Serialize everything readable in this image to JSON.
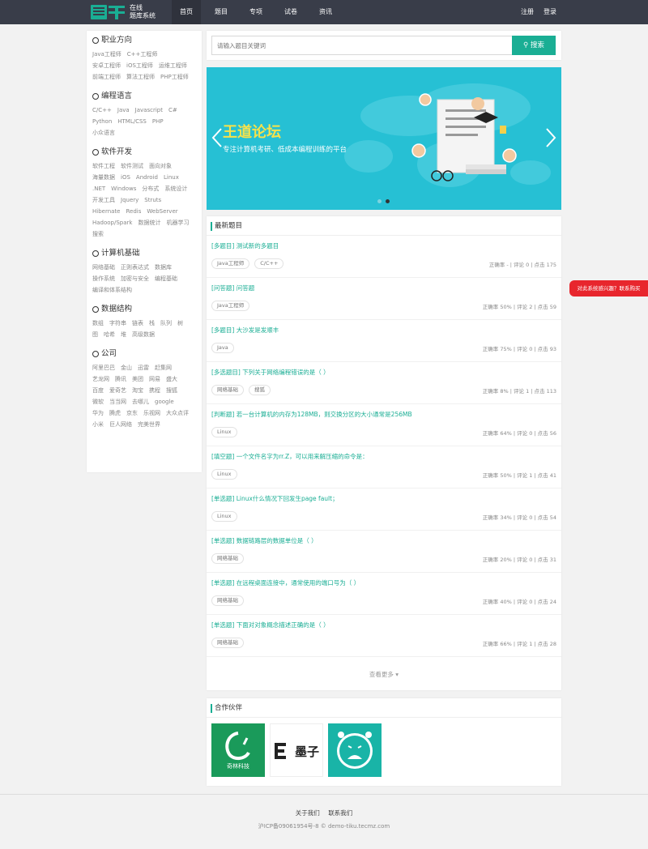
{
  "header": {
    "logo_text_line1": "在线",
    "logo_text_line2": "题库系统",
    "nav": [
      {
        "label": "首页",
        "active": true
      },
      {
        "label": "题目"
      },
      {
        "label": "专项"
      },
      {
        "label": "试卷"
      },
      {
        "label": "资讯"
      }
    ],
    "register_label": "注册",
    "login_label": "登录"
  },
  "sidebar": {
    "categories": [
      {
        "title": "职业方向",
        "tags": [
          "Java工程师",
          "C++工程师",
          "安卓工程师",
          "iOS工程师",
          "运维工程师",
          "前端工程师",
          "算法工程师",
          "PHP工程师"
        ]
      },
      {
        "title": "编程语言",
        "tags": [
          "C/C++",
          "Java",
          "Javascript",
          "C#",
          "Python",
          "HTML/CSS",
          "PHP",
          "小众语言"
        ]
      },
      {
        "title": "软件开发",
        "tags": [
          "软件工程",
          "软件测试",
          "面向对象",
          "海量数据",
          "iOS",
          "Android",
          "Linux",
          ".NET",
          "Windows",
          "分布式",
          "系统设计",
          "开发工具",
          "Jquery",
          "Struts",
          "Hibernate",
          "Redis",
          "WebServer",
          "Hadoop/Spark",
          "数据统计",
          "机器学习",
          "搜索"
        ]
      },
      {
        "title": "计算机基础",
        "tags": [
          "网络基础",
          "正则表达式",
          "数据库",
          "操作系统",
          "加密与安全",
          "编程基础",
          "编译和体系结构"
        ]
      },
      {
        "title": "数据结构",
        "tags": [
          "数组",
          "字符串",
          "链表",
          "栈",
          "队列",
          "树",
          "图",
          "哈希",
          "堆",
          "高级数据"
        ]
      },
      {
        "title": "公司",
        "tags": [
          "阿里巴巴",
          "金山",
          "迅雷",
          "赶集网",
          "艺龙网",
          "腾讯",
          "美团",
          "网易",
          "盛大",
          "百度",
          "爱奇艺",
          "淘宝",
          "携程",
          "搜狐",
          "微软",
          "当当网",
          "去哪儿",
          "google",
          "华为",
          "腾虎",
          "京东",
          "乐视网",
          "大众点评",
          "小米",
          "巨人网络",
          "完美世界"
        ]
      }
    ]
  },
  "search": {
    "placeholder": "请输入题目关键词",
    "button_label": "搜索"
  },
  "banner": {
    "title": "王道论坛",
    "subtitle": "专注计算机考研、低成本编程训练的平台"
  },
  "latest": {
    "heading": "最新题目",
    "questions": [
      {
        "title": "[多题目] 测试新的多题目",
        "tags": [
          "Java工程师",
          "C/C++"
        ],
        "stat": "正确率 - | 评论 0 | 点击 175"
      },
      {
        "title": "[问答题] 问答题",
        "tags": [
          "Java工程师"
        ],
        "stat": "正确率 50% | 评论 2 | 点击 59"
      },
      {
        "title": "[多题目] 大沙发是发顺丰",
        "tags": [
          "Java"
        ],
        "stat": "正确率 75% | 评论 0 | 点击 93"
      },
      {
        "title": "[多选题目] 下列关于网络编程错误的是（ ）",
        "tags": [
          "网络基础",
          "搜狐"
        ],
        "stat": "正确率 8% | 评论 1 | 点击 113"
      },
      {
        "title": "[判断题] 若一台计算机的内存为128MB，则交换分区的大小通常是256MB",
        "tags": [
          "Linux"
        ],
        "stat": "正确率 64% | 评论 0 | 点击 56"
      },
      {
        "title": "[填空题] 一个文件名字为rr.Z，可以用来解压缩的命令是：",
        "tags": [
          "Linux"
        ],
        "stat": "正确率 50% | 评论 1 | 点击 41"
      },
      {
        "title": "[单选题] Linux什么情况下回发生page fault；",
        "tags": [
          "Linux"
        ],
        "stat": "正确率 34% | 评论 0 | 点击 54"
      },
      {
        "title": "[单选题] 数据链路层的数据单位是（ ）",
        "tags": [
          "网络基础"
        ],
        "stat": "正确率 20% | 评论 0 | 点击 31"
      },
      {
        "title": "[单选题] 在远程桌面连接中，通常使用的端口号为（ ）",
        "tags": [
          "网络基础"
        ],
        "stat": "正确率 40% | 评论 0 | 点击 24"
      },
      {
        "title": "[单选题] 下面对对象概念描述正确的是（ ）",
        "tags": [
          "网络基础"
        ],
        "stat": "正确率 66% | 评论 1 | 点击 28"
      }
    ],
    "more_label": "查看更多 ▾"
  },
  "partners": {
    "heading": "合作伙伴",
    "logo1_text": "奇林科技",
    "logo2_text": "墨子"
  },
  "float_tip": "对此系统感兴趣？联系购买",
  "footer": {
    "about": "关于我们",
    "contact": "联系我们",
    "copyright": "沪ICP备09061954号-8 © demo-tiku.tecmz.com"
  },
  "colors": {
    "brand": "#1aae94",
    "header_bg": "#393d49",
    "banner_bg": "#26c0d4",
    "alert": "#e8262d"
  }
}
